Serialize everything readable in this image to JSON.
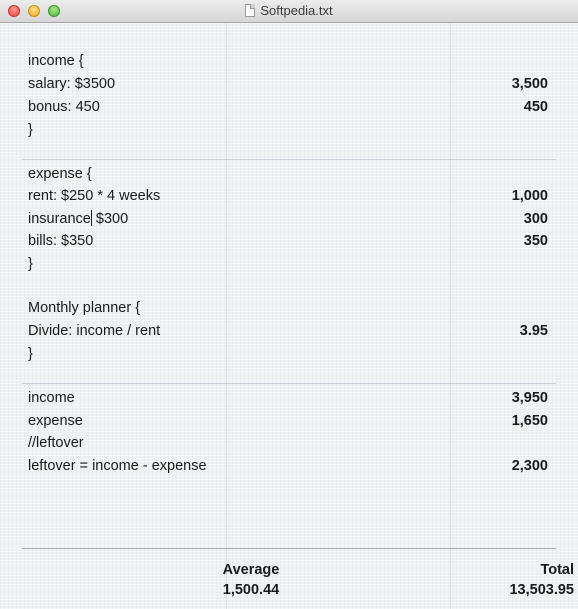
{
  "window": {
    "title": "Softpedia.txt"
  },
  "editor": {
    "lines": [
      {
        "text": "income {",
        "result": ""
      },
      {
        "text": "salary: $3500",
        "result": "3,500"
      },
      {
        "text": "bonus: 450",
        "result": "450"
      },
      {
        "text": "}",
        "result": ""
      },
      {
        "text": "expense {",
        "result": ""
      },
      {
        "text": "rent: $250 * 4 weeks",
        "result": "1,000"
      },
      {
        "text_before_cursor": "insurance",
        "text_after_cursor": " $300",
        "result": "300"
      },
      {
        "text": "bills: $350",
        "result": "350"
      },
      {
        "text": "}",
        "result": ""
      },
      {
        "text": "Monthly planner {",
        "result": ""
      },
      {
        "text": "Divide: income / rent",
        "result": "3.95"
      },
      {
        "text": "}",
        "result": ""
      },
      {
        "text": "income",
        "result": "3,950"
      },
      {
        "text": "expense",
        "result": "1,650"
      },
      {
        "text": "//leftover",
        "result": ""
      },
      {
        "text": "leftover = income - expense",
        "result": "2,300"
      }
    ]
  },
  "footer": {
    "average_label": "Average",
    "average_value": "1,500.44",
    "total_label": "Total",
    "total_value": "13,503.95"
  }
}
